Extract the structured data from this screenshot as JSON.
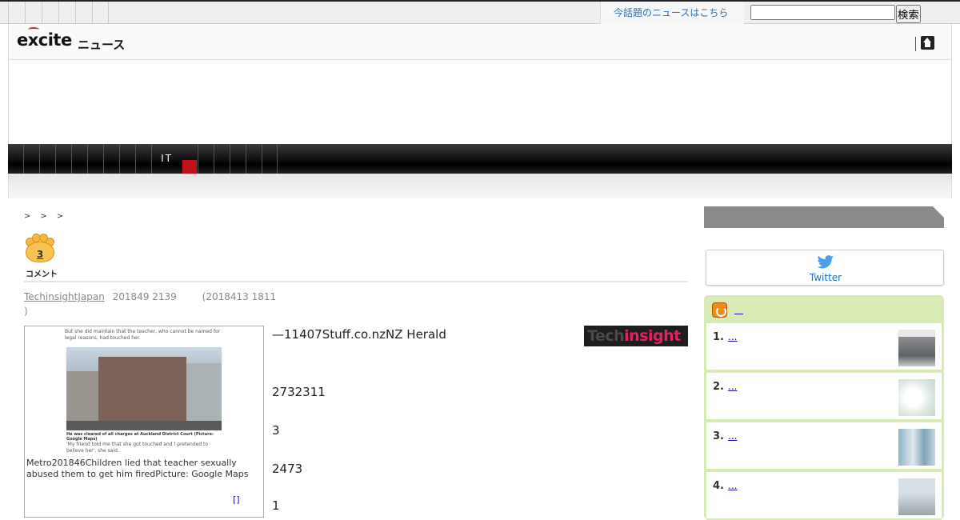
{
  "topbar": {
    "trend_link": "今話題のニュースはこちら",
    "search_placeholder": "",
    "search_button": "検索"
  },
  "logo": {
    "brand": "excite",
    "section": "ニュース"
  },
  "nav": {
    "active_label": "IT"
  },
  "article": {
    "comment_count": "3",
    "comment_label": "コメント",
    "author": "TechinsightJapan",
    "published": "201849 2139",
    "updated": "(2018413 1811",
    "updated_close": ")",
    "photo_caption": "Metro201846Children lied that teacher sexually abused them to get him firedPicture: Google Maps",
    "photo_top_text": "But she did maintain that the teacher, who cannot be named for legal reasons, had touched her.",
    "photo_small_caption": "He was cleared of all charges at Auckland District Court (Picture: Google Maps)",
    "photo_quote": "'My friend told me that she got touched and I pretended to believe her', she said.",
    "photo_link": "[]",
    "paragraphs": [
      "—11407Stuff.co.nzNZ Herald",
      "2732311",
      "3",
      "2473",
      "1"
    ],
    "source_logo_a": "Tech",
    "source_logo_b": "insight"
  },
  "sidebar": {
    "twitter_label": "Twitter",
    "ranking_head_link": "",
    "ranking": [
      {
        "num": "1.",
        "link": "..."
      },
      {
        "num": "2.",
        "link": "..."
      },
      {
        "num": "3.",
        "link": "..."
      },
      {
        "num": "4.",
        "link": "..."
      }
    ]
  }
}
